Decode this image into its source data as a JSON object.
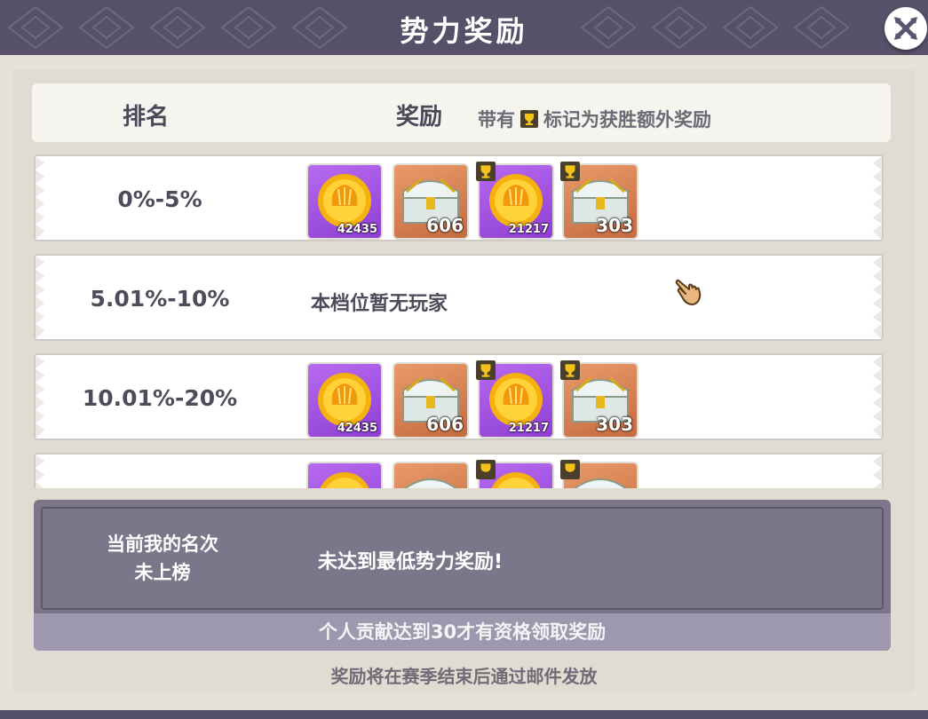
{
  "title": "势力奖励",
  "header": {
    "rank_label": "排名",
    "reward_label": "奖励",
    "note_prefix": "带有",
    "note_suffix": "标记为获胜额外奖励"
  },
  "rows": [
    {
      "rank": "0%-5%",
      "rewards": [
        {
          "kind": "coin",
          "qty": "42435",
          "bonus": false
        },
        {
          "kind": "chest",
          "qty": "606",
          "bonus": false
        },
        {
          "kind": "coin",
          "qty": "21217",
          "bonus": true
        },
        {
          "kind": "chest",
          "qty": "303",
          "bonus": true
        }
      ]
    },
    {
      "rank": "5.01%-10%",
      "empty_text": "本档位暂无玩家",
      "rewards": []
    },
    {
      "rank": "10.01%-20%",
      "rewards": [
        {
          "kind": "coin",
          "qty": "42435",
          "bonus": false
        },
        {
          "kind": "chest",
          "qty": "606",
          "bonus": false
        },
        {
          "kind": "coin",
          "qty": "21217",
          "bonus": true
        },
        {
          "kind": "chest",
          "qty": "303",
          "bonus": true
        }
      ]
    },
    {
      "rank": "",
      "rewards": [
        {
          "kind": "coin",
          "qty": "",
          "bonus": false
        },
        {
          "kind": "chest",
          "qty": "",
          "bonus": false
        },
        {
          "kind": "coin",
          "qty": "",
          "bonus": true
        },
        {
          "kind": "chest",
          "qty": "",
          "bonus": true
        }
      ]
    }
  ],
  "my_rank": {
    "label": "当前我的名次",
    "status": "未上榜",
    "message": "未达到最低势力奖励!",
    "condition": "个人贡献达到30才有资格领取奖励"
  },
  "footer": "奖励将在赛季结束后通过邮件发放",
  "icons": {
    "close": "close-icon",
    "bonus": "trophy-icon",
    "coin": "shell-coin-icon",
    "chest": "treasure-chest-icon",
    "cursor": "pointing-hand-icon"
  },
  "colors": {
    "title_bar": "#575069",
    "panel": "#e0dcd2",
    "coin_bg": "#9b50e0",
    "chest_bg": "#d88256",
    "my_rank_bg": "#7b7689"
  }
}
